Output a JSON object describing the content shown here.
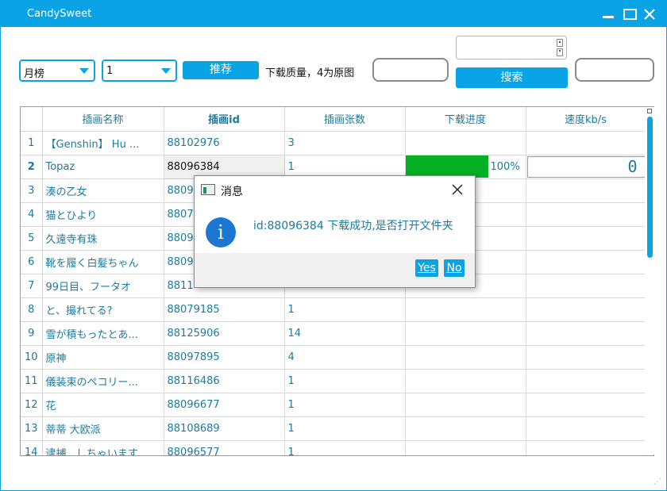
{
  "window": {
    "title": "CandySweet"
  },
  "toolbar": {
    "rank_select": "月榜",
    "quality_select": "1",
    "recommend_label": "推荐",
    "quality_label": "下载质量，4为原图",
    "search_label": "搜索",
    "input1_value": "",
    "input2_value": "",
    "spin_value": ""
  },
  "table": {
    "headers": [
      "插画名称",
      "插画id",
      "插画张数",
      "下载进度",
      "速度kb/s"
    ],
    "rows": [
      {
        "num": "1",
        "name": "【Genshin】 Hu ...",
        "id": "88102976",
        "count": "3",
        "progress": "",
        "speed": ""
      },
      {
        "num": "2",
        "name": "Topaz",
        "id": "88096384",
        "count": "1",
        "progress": "100%",
        "speed": "0"
      },
      {
        "num": "3",
        "name": "湊の乙女",
        "id": "8809",
        "count": "",
        "progress": "",
        "speed": ""
      },
      {
        "num": "4",
        "name": "猫とひより",
        "id": "8807",
        "count": "",
        "progress": "",
        "speed": ""
      },
      {
        "num": "5",
        "name": "久遠寺有珠",
        "id": "8809",
        "count": "",
        "progress": "",
        "speed": ""
      },
      {
        "num": "6",
        "name": "靴を履く白髪ちゃん",
        "id": "8809",
        "count": "",
        "progress": "",
        "speed": ""
      },
      {
        "num": "7",
        "name": "99日目、フータオ",
        "id": "8811",
        "count": "",
        "progress": "",
        "speed": ""
      },
      {
        "num": "8",
        "name": "と、撮れてる?",
        "id": "88079185",
        "count": "1",
        "progress": "",
        "speed": ""
      },
      {
        "num": "9",
        "name": "雪が積もったとあ...",
        "id": "88125906",
        "count": "14",
        "progress": "",
        "speed": ""
      },
      {
        "num": "10",
        "name": "原神",
        "id": "88097895",
        "count": "4",
        "progress": "",
        "speed": ""
      },
      {
        "num": "11",
        "name": "儀装束のペコリー...",
        "id": "88116486",
        "count": "1",
        "progress": "",
        "speed": ""
      },
      {
        "num": "12",
        "name": "花",
        "id": "88096677",
        "count": "1",
        "progress": "",
        "speed": ""
      },
      {
        "num": "13",
        "name": "蒂蒂 大欧派",
        "id": "88108689",
        "count": "1",
        "progress": "",
        "speed": ""
      },
      {
        "num": "14",
        "name": "逮捕...しちゃいます...",
        "id": "88096577",
        "count": "1",
        "progress": "",
        "speed": ""
      }
    ]
  },
  "dialog": {
    "title": "消息",
    "message": "id:88096384  下载成功,是否打开文件夹",
    "yes_label": "Yes",
    "no_label": "No"
  },
  "colors": {
    "accent": "#0aa3e6",
    "progress": "#06b025",
    "text": "#1b7a9e"
  }
}
